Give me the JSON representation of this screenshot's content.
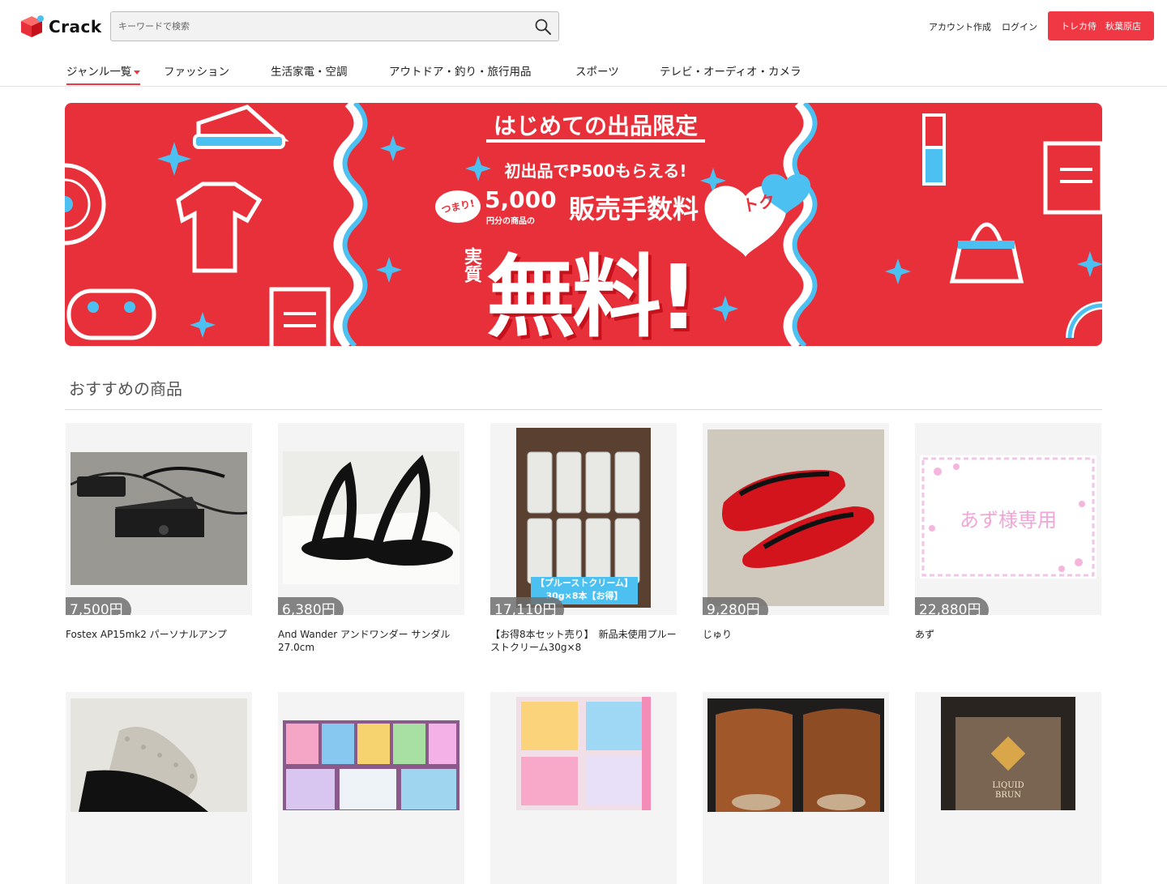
{
  "brand": {
    "name": "Crack",
    "accent": "#ef3844"
  },
  "search": {
    "placeholder": "キーワードで検索",
    "icon": "search-icon"
  },
  "header": {
    "create_account": "アカウント作成",
    "login": "ログイン",
    "store_button": "トレカ侍　秋葉原店"
  },
  "nav": {
    "genre": "ジャンル一覧",
    "items": [
      "ファッション",
      "生活家電・空調",
      "アウトドア・釣り・旅行用品",
      "スポーツ",
      "テレビ・オーディオ・カメラ"
    ]
  },
  "banner": {
    "headline": "はじめての出品限定",
    "line1": "初出品でP500もらえる!",
    "bubble": "つまり!",
    "amount": "5,000",
    "amount_sub": "円分の商品の",
    "fee": "販売手数料",
    "jisshitsu": "実質",
    "free": "無料!",
    "toku": "トク",
    "colors": {
      "bg": "#e8303a",
      "blue": "#4cc0f0",
      "white": "#ffffff"
    }
  },
  "section": {
    "title": "おすすめの商品"
  },
  "products": [
    {
      "price": "7,500円",
      "name": "Fostex AP15mk2 パーソナルアンプ"
    },
    {
      "price": "6,380円",
      "name": "And Wander アンドワンダー サンダル 27.0cm"
    },
    {
      "price": "17,110円",
      "name": "【お得8本セット売り】　新品未使用プルーストクリーム30g×8",
      "overlay1": "【プルーストクリーム】",
      "overlay2": "30g×8本【お得】"
    },
    {
      "price": "9,280円",
      "name": "じゅり"
    },
    {
      "price": "22,880円",
      "name": "あず",
      "card_text": "あず様専用"
    }
  ]
}
